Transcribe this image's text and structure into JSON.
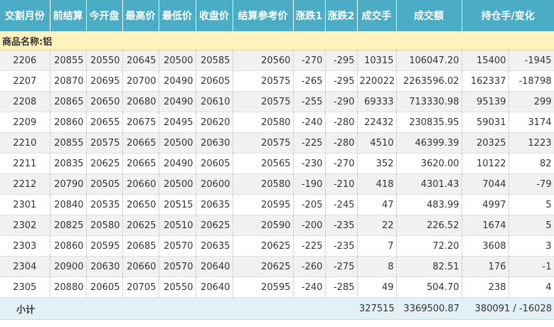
{
  "headers": [
    "交割月份",
    "前结算",
    "今开盘",
    "最高价",
    "最低价",
    "收盘价",
    "结算参考价",
    "涨跌1",
    "涨跌2",
    "成交手",
    "成交额",
    "持仓手/变化"
  ],
  "category_label": "商品名称:铝",
  "rows": [
    [
      "2206",
      "20855",
      "20550",
      "20645",
      "20500",
      "20585",
      "20560",
      "-270",
      "-295",
      "10315",
      "106047.20",
      "15400",
      "-1945"
    ],
    [
      "2207",
      "20870",
      "20695",
      "20700",
      "20490",
      "20605",
      "20575",
      "-265",
      "-295",
      "220022",
      "2263596.02",
      "162337",
      "-18798"
    ],
    [
      "2208",
      "20865",
      "20650",
      "20680",
      "20490",
      "20610",
      "20575",
      "-255",
      "-290",
      "69333",
      "713330.98",
      "95139",
      "299"
    ],
    [
      "2209",
      "20860",
      "20655",
      "20675",
      "20495",
      "20620",
      "20580",
      "-240",
      "-280",
      "22432",
      "230835.95",
      "59031",
      "3174"
    ],
    [
      "2210",
      "20855",
      "20575",
      "20665",
      "20500",
      "20630",
      "20575",
      "-225",
      "-280",
      "4510",
      "46399.39",
      "20325",
      "1223"
    ],
    [
      "2211",
      "20835",
      "20625",
      "20665",
      "20490",
      "20605",
      "20565",
      "-230",
      "-270",
      "352",
      "3620.00",
      "10122",
      "82"
    ],
    [
      "2212",
      "20790",
      "20505",
      "20660",
      "20500",
      "20600",
      "20580",
      "-190",
      "-210",
      "418",
      "4301.43",
      "7044",
      "-79"
    ],
    [
      "2301",
      "20840",
      "20535",
      "20650",
      "20515",
      "20635",
      "20595",
      "-205",
      "-245",
      "47",
      "483.99",
      "4997",
      "5"
    ],
    [
      "2302",
      "20825",
      "20580",
      "20625",
      "20510",
      "20625",
      "20590",
      "-200",
      "-235",
      "22",
      "226.52",
      "1674",
      "5"
    ],
    [
      "2303",
      "20860",
      "20595",
      "20685",
      "20570",
      "20635",
      "20625",
      "-225",
      "-235",
      "7",
      "72.20",
      "3608",
      "3"
    ],
    [
      "2304",
      "20900",
      "20630",
      "20660",
      "20570",
      "20640",
      "20625",
      "-260",
      "-275",
      "8",
      "82.51",
      "176",
      "-1"
    ],
    [
      "2305",
      "20880",
      "20605",
      "20705",
      "20550",
      "20640",
      "20595",
      "-240",
      "-285",
      "49",
      "504.70",
      "238",
      "4"
    ]
  ],
  "subtotal": {
    "label": "小计",
    "volume": "327515",
    "turnover": "3369500.87",
    "open_interest": "380091 / -16028"
  }
}
